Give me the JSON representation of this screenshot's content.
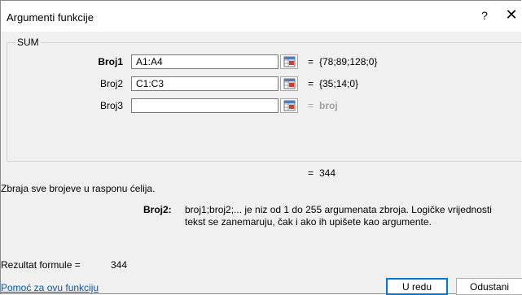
{
  "window": {
    "title": "Argumenti funkcije",
    "help_glyph": "?",
    "close_glyph": "✕"
  },
  "function_name": "SUM",
  "arguments": [
    {
      "label": "Broj1",
      "value": "A1:A4",
      "result": "{78;89;128;0}"
    },
    {
      "label": "Broj2",
      "value": "C1:C3",
      "result": "{35;14;0}"
    },
    {
      "label": "Broj3",
      "value": "",
      "result": "broj"
    }
  ],
  "equals": "=",
  "function_value": "344",
  "function_description": "Zbraja sve brojeve u rasponu ćelija.",
  "argument_description": {
    "label": "Broj2:",
    "line1": "broj1;broj2;... je niz od 1 do 255 argumenata zbroja. Logičke vrijednosti",
    "line2": "tekst se zanemaruju, čak i ako ih upišete kao argumente."
  },
  "formula_result": {
    "label": "Rezultat formule =",
    "value": "344"
  },
  "help_link": "Pomoć za ovu funkciju",
  "buttons": {
    "ok": "U redu",
    "cancel": "Odustani"
  }
}
